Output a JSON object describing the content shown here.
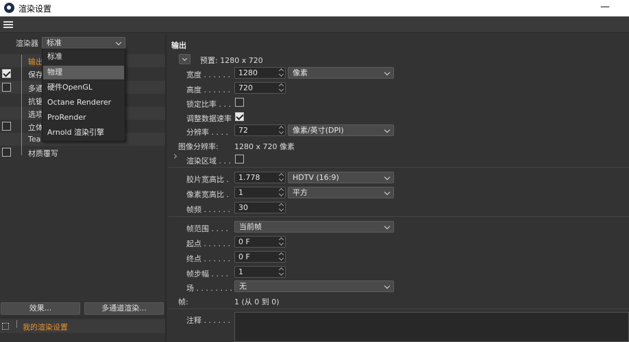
{
  "window": {
    "title": "渲染设置",
    "minimize": "—"
  },
  "left": {
    "renderer_label": "渲染器",
    "renderer_value": "标准",
    "tree": [
      {
        "label": "输出",
        "checked": null,
        "active": true
      },
      {
        "label": "保存",
        "checked": true
      },
      {
        "label": "多通",
        "checked": false
      },
      {
        "label": "抗锯",
        "checked": null
      },
      {
        "label": "选项",
        "checked": null
      },
      {
        "label": "立体",
        "checked": false
      },
      {
        "label": "Tea",
        "checked": null
      },
      {
        "label": "材质覆写",
        "checked": false
      }
    ],
    "effects_button": "效果...",
    "multipass_button": "多通道渲染...",
    "preset": "我的渲染设置"
  },
  "dropdown": {
    "items": [
      "标准",
      "物理",
      "硬件OpenGL",
      "Octane Renderer",
      "ProRender",
      "Arnold 渲染引擎"
    ],
    "selected": 1
  },
  "right": {
    "section": "输出",
    "preset": "预置: 1280 x 720",
    "width": {
      "label": "宽度 . . . . . .",
      "value": "1280",
      "unit": "像素"
    },
    "height": {
      "label": "高度 . . . . . .",
      "value": "720"
    },
    "lock_ratio": {
      "label": "锁定比率 . . .",
      "checked": false
    },
    "adjust_rate": {
      "label": "调整数据速率",
      "checked": true
    },
    "resolution": {
      "label": "分辨率 . . . .",
      "value": "72",
      "unit": "像素/英寸(DPI)"
    },
    "image_resolution": {
      "label": "图像分辨率:",
      "value": "1280 x 720 像素"
    },
    "render_region": {
      "label": "渲染区域 . . .",
      "checked": false
    },
    "film_aspect": {
      "label": "胶片宽高比 .",
      "value": "1.778",
      "preset": "HDTV (16:9)"
    },
    "pixel_aspect": {
      "label": "像素宽高比 .",
      "value": "1",
      "preset": "平方"
    },
    "fps": {
      "label": "帧频 . . . . . .",
      "value": "30"
    },
    "frame_range": {
      "label": "帧范围 . . . .",
      "value": "当前帧"
    },
    "start": {
      "label": "起点 . . . . . .",
      "value": "0 F"
    },
    "end": {
      "label": "终点 . . . . . .",
      "value": "0 F"
    },
    "step": {
      "label": "帧步幅 . . . .",
      "value": "1"
    },
    "field": {
      "label": "场 . . . . . . . .",
      "value": "无"
    },
    "frames": {
      "label": "帧:",
      "value": "1 (从 0 到 0)"
    },
    "notes": {
      "label": "注释 . . . . . ."
    }
  }
}
